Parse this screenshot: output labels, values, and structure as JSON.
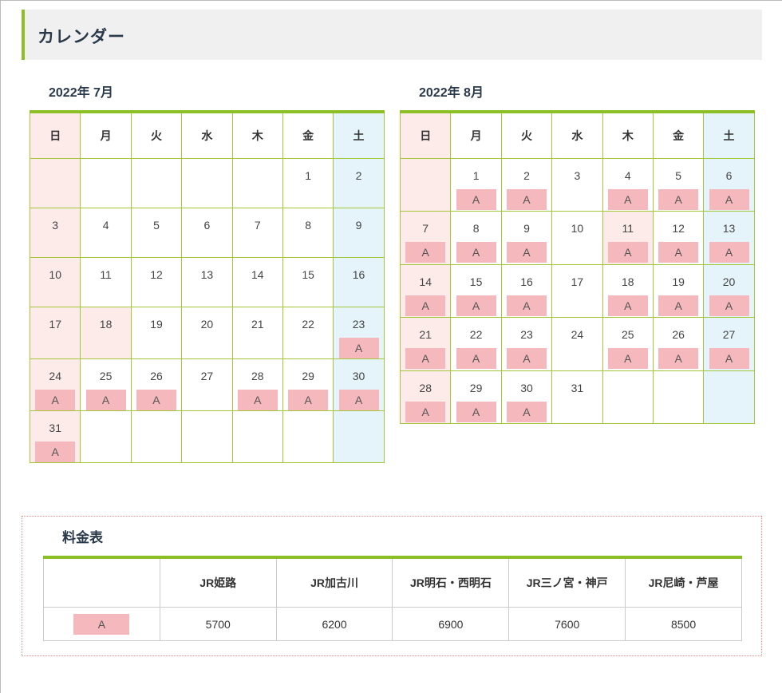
{
  "header": {
    "title": "カレンダー"
  },
  "weekdays": [
    "日",
    "月",
    "火",
    "水",
    "木",
    "金",
    "土"
  ],
  "july": {
    "title": "2022年 7月",
    "weeks": [
      [
        {
          "d": "",
          "m": ""
        },
        {
          "d": "",
          "m": ""
        },
        {
          "d": "",
          "m": ""
        },
        {
          "d": "",
          "m": ""
        },
        {
          "d": "",
          "m": ""
        },
        {
          "d": "1",
          "m": ""
        },
        {
          "d": "2",
          "m": ""
        }
      ],
      [
        {
          "d": "3",
          "m": ""
        },
        {
          "d": "4",
          "m": ""
        },
        {
          "d": "5",
          "m": ""
        },
        {
          "d": "6",
          "m": ""
        },
        {
          "d": "7",
          "m": ""
        },
        {
          "d": "8",
          "m": ""
        },
        {
          "d": "9",
          "m": ""
        }
      ],
      [
        {
          "d": "10",
          "m": ""
        },
        {
          "d": "11",
          "m": ""
        },
        {
          "d": "12",
          "m": ""
        },
        {
          "d": "13",
          "m": ""
        },
        {
          "d": "14",
          "m": ""
        },
        {
          "d": "15",
          "m": ""
        },
        {
          "d": "16",
          "m": ""
        }
      ],
      [
        {
          "d": "17",
          "m": ""
        },
        {
          "d": "18",
          "m": "",
          "holiday": true
        },
        {
          "d": "19",
          "m": ""
        },
        {
          "d": "20",
          "m": ""
        },
        {
          "d": "21",
          "m": ""
        },
        {
          "d": "22",
          "m": ""
        },
        {
          "d": "23",
          "m": "A"
        }
      ],
      [
        {
          "d": "24",
          "m": "A"
        },
        {
          "d": "25",
          "m": "A"
        },
        {
          "d": "26",
          "m": "A"
        },
        {
          "d": "27",
          "m": ""
        },
        {
          "d": "28",
          "m": "A"
        },
        {
          "d": "29",
          "m": "A"
        },
        {
          "d": "30",
          "m": "A"
        }
      ],
      [
        {
          "d": "31",
          "m": "A"
        },
        {
          "d": "",
          "m": ""
        },
        {
          "d": "",
          "m": ""
        },
        {
          "d": "",
          "m": ""
        },
        {
          "d": "",
          "m": ""
        },
        {
          "d": "",
          "m": ""
        },
        {
          "d": "",
          "m": ""
        }
      ]
    ]
  },
  "august": {
    "title": "2022年 8月",
    "weeks": [
      [
        {
          "d": "",
          "m": ""
        },
        {
          "d": "1",
          "m": "A"
        },
        {
          "d": "2",
          "m": "A"
        },
        {
          "d": "3",
          "m": ""
        },
        {
          "d": "4",
          "m": "A"
        },
        {
          "d": "5",
          "m": "A"
        },
        {
          "d": "6",
          "m": "A"
        }
      ],
      [
        {
          "d": "7",
          "m": "A"
        },
        {
          "d": "8",
          "m": "A"
        },
        {
          "d": "9",
          "m": "A"
        },
        {
          "d": "10",
          "m": ""
        },
        {
          "d": "11",
          "m": "A",
          "holiday": true
        },
        {
          "d": "12",
          "m": "A"
        },
        {
          "d": "13",
          "m": "A"
        }
      ],
      [
        {
          "d": "14",
          "m": "A"
        },
        {
          "d": "15",
          "m": "A"
        },
        {
          "d": "16",
          "m": "A"
        },
        {
          "d": "17",
          "m": ""
        },
        {
          "d": "18",
          "m": "A"
        },
        {
          "d": "19",
          "m": "A"
        },
        {
          "d": "20",
          "m": "A"
        }
      ],
      [
        {
          "d": "21",
          "m": "A"
        },
        {
          "d": "22",
          "m": "A"
        },
        {
          "d": "23",
          "m": "A"
        },
        {
          "d": "24",
          "m": ""
        },
        {
          "d": "25",
          "m": "A"
        },
        {
          "d": "26",
          "m": "A"
        },
        {
          "d": "27",
          "m": "A"
        }
      ],
      [
        {
          "d": "28",
          "m": "A"
        },
        {
          "d": "29",
          "m": "A"
        },
        {
          "d": "30",
          "m": "A"
        },
        {
          "d": "31",
          "m": ""
        },
        {
          "d": "",
          "m": ""
        },
        {
          "d": "",
          "m": ""
        },
        {
          "d": "",
          "m": ""
        }
      ]
    ]
  },
  "fees": {
    "title": "料金表",
    "columns": [
      "",
      "JR姫路",
      "JR加古川",
      "JR明石・西明石",
      "JR三ノ宮・神戸",
      "JR尼崎・芦屋"
    ],
    "row_label": "A",
    "values": [
      "5700",
      "6200",
      "6900",
      "7600",
      "8500"
    ]
  },
  "colors": {
    "accent": "#8cbf26",
    "grid": "#a4c639",
    "sunday_bg": "#fdebea",
    "saturday_bg": "#e5f4fa",
    "mark_bg": "#f4b8bd"
  }
}
